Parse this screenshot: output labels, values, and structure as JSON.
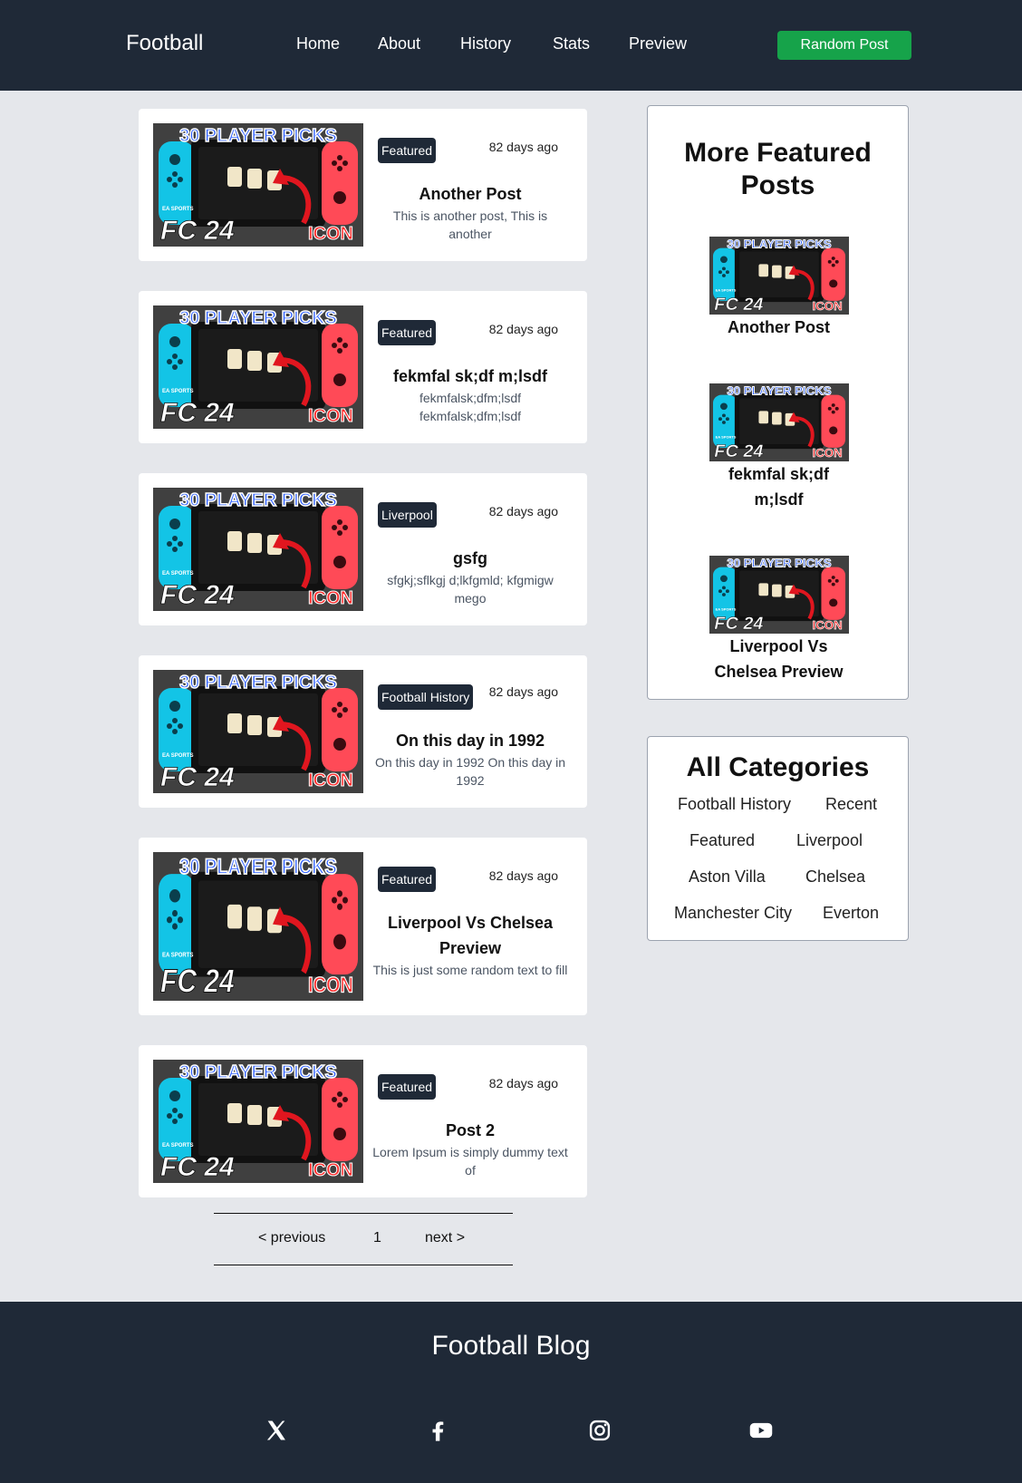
{
  "header": {
    "brand": "Football",
    "nav": [
      "Home",
      "About",
      "History",
      "Stats",
      "Preview"
    ],
    "random_post": "Random Post",
    "colors": {
      "bar": "#1f2937",
      "button": "#16a34a"
    }
  },
  "thumbnail": {
    "headline": "30 PLAYER PICKS",
    "tag": "ICON",
    "brand_top": "EA SPORTS",
    "brand_logo": "FC 24"
  },
  "posts": [
    {
      "badge": "Featured",
      "time": "82 days ago",
      "title": "Another Post",
      "excerpt": "This is another post, This is another"
    },
    {
      "badge": "Featured",
      "time": "82 days ago",
      "title": "fekmfal sk;df m;lsdf",
      "excerpt": "fekmfalsk;dfm;lsdf fekmfalsk;dfm;lsdf"
    },
    {
      "badge": "Liverpool",
      "time": "82 days ago",
      "title": "gsfg",
      "excerpt": "sfgkj;sflkgj d;lkfgmld; kfgmigw mego"
    },
    {
      "badge": "Football History",
      "time": "82 days ago",
      "title": "On this day in 1992",
      "excerpt": "On this day in 1992 On this day in 1992"
    },
    {
      "badge": "Featured",
      "time": "82 days ago",
      "title": "Liverpool Vs Chelsea Preview",
      "excerpt": "This is just some random text to fill"
    },
    {
      "badge": "Featured",
      "time": "82 days ago",
      "title": "Post 2",
      "excerpt": "Lorem Ipsum is simply dummy text of"
    }
  ],
  "pagination": {
    "previous": "< previous",
    "page": "1",
    "next": "next >"
  },
  "sidebar": {
    "featured_title": "More Featured Posts",
    "featured": [
      "Another Post",
      "fekmfal sk;df m;lsdf",
      "Liverpool Vs Chelsea Preview"
    ],
    "categories_title": "All Categories",
    "categories": [
      "Football History",
      "Recent",
      "Featured",
      "Liverpool",
      "Aston Villa",
      "Chelsea",
      "Manchester City",
      "Everton"
    ]
  },
  "footer": {
    "title": "Football Blog",
    "social_icons": [
      "x-icon",
      "facebook-icon",
      "instagram-icon",
      "youtube-icon"
    ]
  }
}
